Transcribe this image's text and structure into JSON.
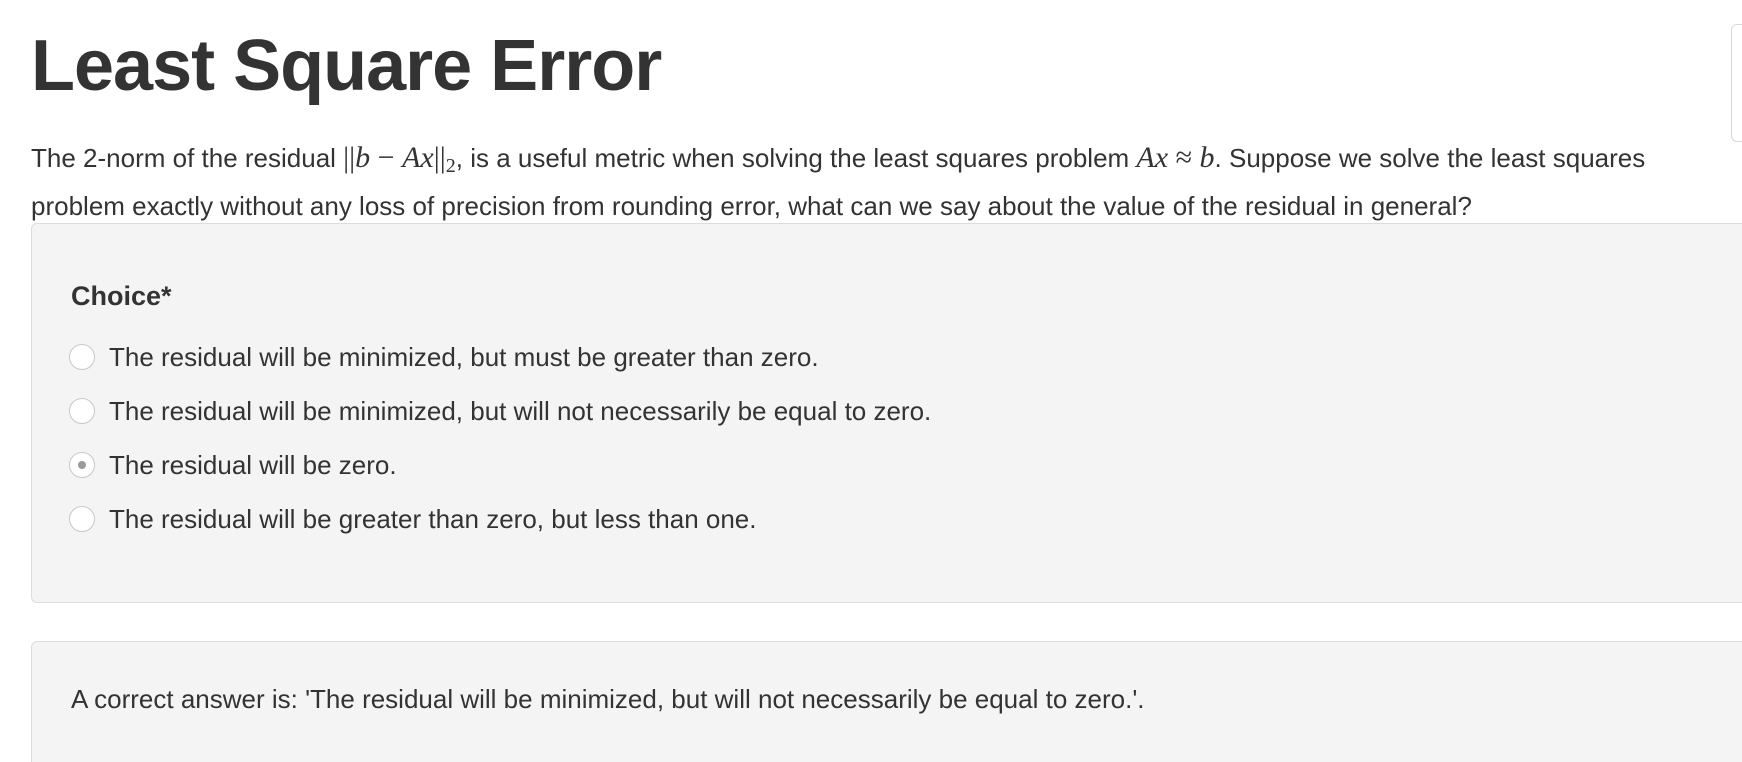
{
  "page": {
    "title": "Least Square Error"
  },
  "prompt": {
    "part1": "The 2-norm of the residual ",
    "norm_open": "||",
    "norm_b": "b",
    "norm_minus": " − ",
    "norm_Ax": "Ax",
    "norm_close": "||",
    "norm_sub": "2",
    "part2": ", is a useful metric when solving the least squares problem ",
    "eq_Ax": "Ax",
    "eq_approx": " ≈ ",
    "eq_b": "b",
    "part3": ". Suppose we solve the least squares problem exactly without any loss of precision from rounding error, what can we say about the value of the residual in general?"
  },
  "question": {
    "label": "Choice*",
    "selected_index": 2,
    "options": [
      {
        "label": "The residual will be minimized, but must be greater than zero."
      },
      {
        "label": "The residual will be minimized, but will not necessarily be equal to zero."
      },
      {
        "label": "The residual will be zero."
      },
      {
        "label": "The residual will be greater than zero, but less than one."
      }
    ]
  },
  "feedback": {
    "text": "A correct answer is: 'The residual will be minimized, but will not necessarily be equal to zero.'."
  }
}
